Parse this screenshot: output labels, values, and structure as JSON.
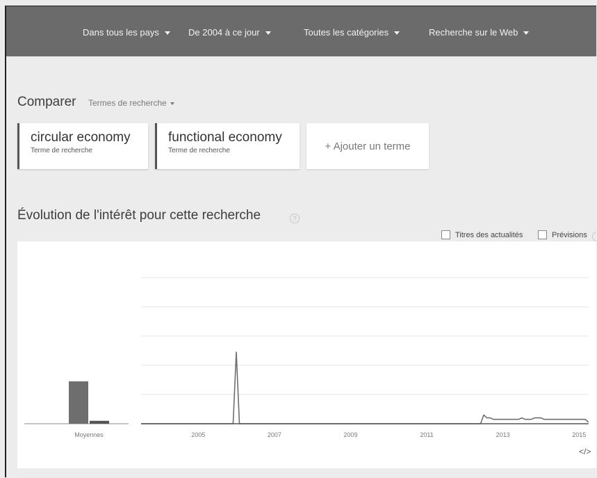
{
  "filters": [
    {
      "label": "Dans tous les pays"
    },
    {
      "label": "De 2004 à ce jour"
    },
    {
      "label": "Toutes les catégories"
    },
    {
      "label": "Recherche sur le Web"
    }
  ],
  "compare": {
    "title": "Comparer",
    "type_label": "Termes de recherche"
  },
  "terms": [
    {
      "name": "circular economy",
      "sub": "Terme de recherche"
    },
    {
      "name": "functional economy",
      "sub": "Terme de recherche"
    }
  ],
  "add_term_label": "+ Ajouter un terme",
  "section_title": "Évolution de l'intérêt pour cette recherche",
  "help_glyph": "?",
  "options": {
    "news": "Titres des actualités",
    "forecast": "Prévisions"
  },
  "embed_glyph": "</>",
  "colors": {
    "circular": "#6e6e6e",
    "functional": "#555555",
    "topbar": "#6b6b6b"
  },
  "chart_data": {
    "type": "line",
    "averages": {
      "label": "Moyennes",
      "values": [
        29,
        2
      ]
    },
    "x_ticks": [
      "2005",
      "2007",
      "2009",
      "2011",
      "2013",
      "2015"
    ],
    "ylim": [
      0,
      100
    ],
    "grid": true,
    "series": [
      {
        "name": "circular economy",
        "start": 2004.0,
        "step_years": 0.0833,
        "values": [
          0,
          0,
          0,
          0,
          0,
          0,
          0,
          0,
          0,
          0,
          0,
          0,
          0,
          0,
          0,
          0,
          0,
          0,
          0,
          0,
          0,
          0,
          0,
          0,
          0,
          0,
          0,
          0,
          0,
          0,
          49,
          0,
          0,
          0,
          0,
          0,
          0,
          0,
          0,
          0,
          0,
          0,
          0,
          0,
          0,
          0,
          0,
          0,
          0,
          0,
          0,
          0,
          0,
          0,
          0,
          0,
          0,
          0,
          0,
          0,
          0,
          0,
          0,
          0,
          0,
          0,
          0,
          0,
          0,
          0,
          0,
          0,
          0,
          0,
          0,
          0,
          0,
          0,
          0,
          0,
          0,
          0,
          0,
          0,
          0,
          0,
          0,
          0,
          0,
          0,
          0,
          0,
          0,
          0,
          0,
          0,
          0,
          0,
          0,
          0,
          0,
          0,
          0,
          0,
          0,
          0,
          0,
          0,
          6,
          4,
          4,
          3,
          3,
          3,
          3,
          3,
          3,
          3,
          3,
          3,
          4,
          3,
          3,
          3,
          4,
          4,
          4,
          3,
          3,
          3,
          3,
          3,
          3,
          3,
          3,
          3,
          3,
          3,
          3,
          3,
          3,
          1
        ]
      },
      {
        "name": "functional economy",
        "start": 2004.0,
        "step_years": 0.0833,
        "values": [
          0,
          0,
          0,
          0,
          0,
          0,
          0,
          0,
          0,
          0,
          0,
          0,
          0,
          0,
          0,
          0,
          0,
          0,
          0,
          0,
          0,
          0,
          0,
          0,
          0,
          0,
          0,
          0,
          0,
          0,
          0,
          0,
          0,
          0,
          0,
          0,
          0,
          0,
          0,
          0,
          0,
          0,
          0,
          0,
          0,
          0,
          0,
          0,
          0,
          0,
          0,
          0,
          0,
          0,
          0,
          0,
          0,
          0,
          0,
          0,
          0,
          0,
          0,
          0,
          0,
          0,
          0,
          0,
          0,
          0,
          0,
          0,
          0,
          0,
          0,
          0,
          0,
          0,
          0,
          0,
          0,
          0,
          0,
          0,
          0,
          0,
          0,
          0,
          0,
          0,
          0,
          0,
          0,
          0,
          0,
          0,
          0,
          0,
          0,
          0,
          0,
          0,
          0,
          0,
          0,
          0,
          0,
          0,
          0,
          0,
          0,
          0,
          0,
          0,
          0,
          0,
          0,
          0,
          0,
          0,
          0,
          0,
          0,
          0,
          0,
          0,
          0,
          0,
          0,
          0,
          0,
          0,
          0,
          0,
          0,
          0,
          0,
          0,
          0,
          0,
          0,
          0
        ]
      }
    ]
  }
}
